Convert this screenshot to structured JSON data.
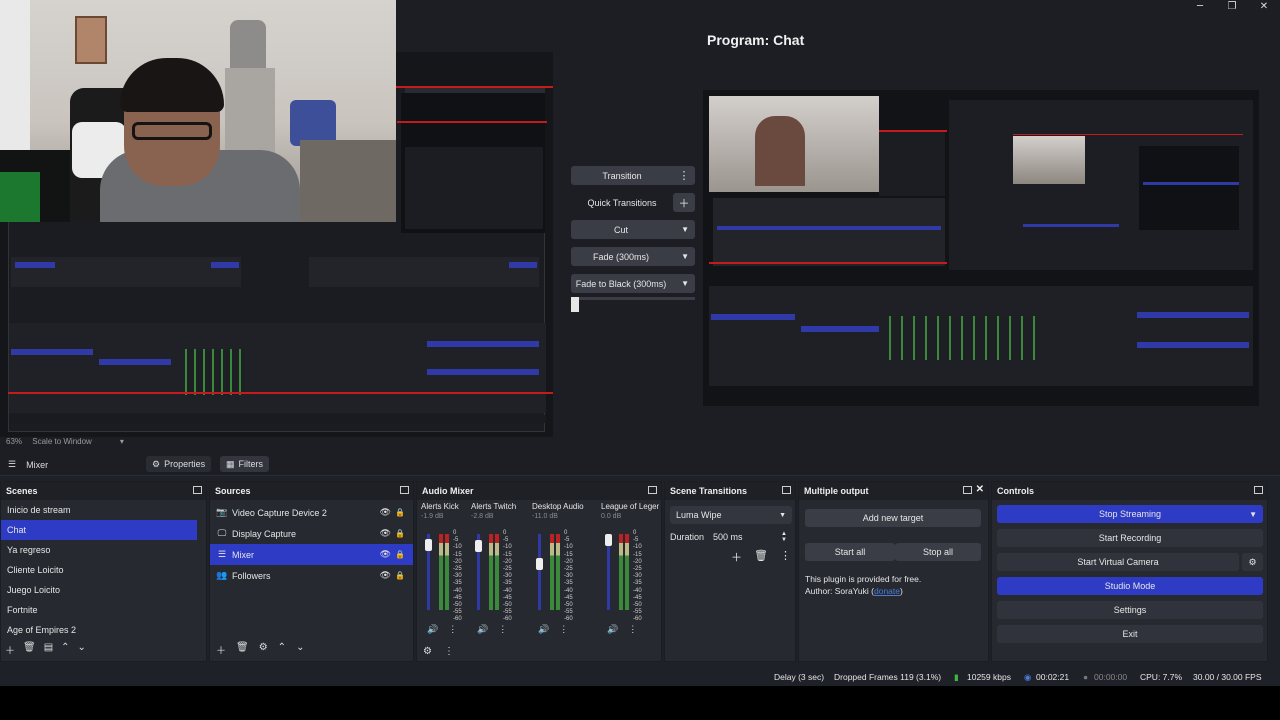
{
  "window": {
    "minimize": "─",
    "maximize": "❐",
    "close": "✕"
  },
  "preview": {
    "program_title": "Program: Chat",
    "zoom": "63%",
    "scale_mode": "Scale to Window"
  },
  "transitions_panel": {
    "transition_label": "Transition",
    "quick_transitions_label": "Quick Transitions",
    "cut_label": "Cut",
    "fade_label": "Fade (300ms)",
    "fade_black_label": "Fade to Black (300ms)"
  },
  "context_bar": {
    "source_name": "Mixer",
    "properties_label": "Properties",
    "filters_label": "Filters"
  },
  "scenes": {
    "title": "Scenes",
    "items": [
      "Inicio de stream",
      "Chat",
      "Ya regreso",
      "Cliente Loicito",
      "Juego Loicito",
      "Fortnite",
      "Age of Empires 2"
    ],
    "selected_index": 1
  },
  "sources": {
    "title": "Sources",
    "items": [
      {
        "name": "Video Capture Device 2",
        "icon": "camera-icon"
      },
      {
        "name": "Display Capture",
        "icon": "monitor-icon"
      },
      {
        "name": "Mixer",
        "icon": "list-icon"
      },
      {
        "name": "Followers",
        "icon": "group-icon"
      }
    ],
    "selected_index": 2
  },
  "audio_mixer": {
    "title": "Audio Mixer",
    "channels": [
      {
        "name": "Alerts Kick",
        "db": "-1.9 dB",
        "level": 0.92
      },
      {
        "name": "Alerts Twitch",
        "db": "-2.8 dB",
        "level": 0.9
      },
      {
        "name": "Desktop Audio",
        "db": "-11.0 dB",
        "level": 0.62
      },
      {
        "name": "League of Legends",
        "db": "0.0 dB",
        "level": 1.0
      }
    ],
    "scale_labels": "0\n-5\n-10\n-15\n-20\n-25\n-30\n-35\n-40\n-45\n-50\n-55\n-60"
  },
  "scene_transitions": {
    "title": "Scene Transitions",
    "selected": "Luma Wipe",
    "duration_label": "Duration",
    "duration_value": "500 ms"
  },
  "multiple_output": {
    "title": "Multiple output",
    "add_target": "Add new target",
    "start_all": "Start all",
    "stop_all": "Stop all",
    "plugin_note": "This plugin is provided for free.",
    "author_prefix": "Author: SoraYuki (",
    "donate": "donate",
    "author_suffix": ")"
  },
  "controls": {
    "title": "Controls",
    "stop_streaming": "Stop Streaming",
    "start_recording": "Start Recording",
    "start_virtual_camera": "Start Virtual Camera",
    "studio_mode": "Studio Mode",
    "settings": "Settings",
    "exit": "Exit"
  },
  "status_bar": {
    "delay": "Delay (3 sec)",
    "dropped_frames": "Dropped Frames 119 (3.1%)",
    "bitrate": "10259 kbps",
    "stream_time": "00:02:21",
    "rec_time": "00:00:00",
    "cpu": "CPU: 7.7%",
    "fps": "30.00 / 30.00 FPS"
  },
  "colors": {
    "accent": "#2e3bc4",
    "panel": "#272930",
    "background": "#1f2128",
    "recording_red": "#c41c1c",
    "bitrate_green": "#3fb83f"
  }
}
